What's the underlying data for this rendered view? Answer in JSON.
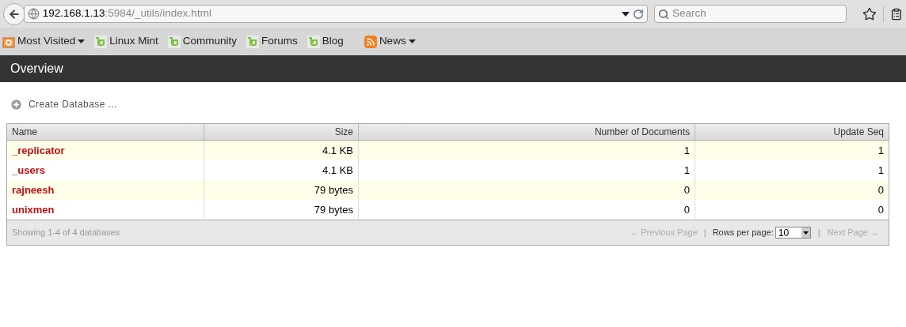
{
  "browser": {
    "url_host": "192.168.1.13",
    "url_rest": ":5984/_utils/index.html",
    "search": {
      "placeholder": "Search"
    }
  },
  "bookmarks": [
    {
      "kind": "folder",
      "label": "Most Visited",
      "menu": true
    },
    {
      "kind": "mint",
      "label": "Linux Mint",
      "menu": false
    },
    {
      "kind": "mint",
      "label": "Community",
      "menu": false
    },
    {
      "kind": "mint",
      "label": "Forums",
      "menu": false
    },
    {
      "kind": "mint",
      "label": "Blog",
      "menu": false
    },
    {
      "kind": "feed",
      "label": "News",
      "menu": true
    }
  ],
  "page": {
    "title": "Overview",
    "create_action": "Create Database ..."
  },
  "table": {
    "columns": [
      "Name",
      "Size",
      "Number of Documents",
      "Update Seq"
    ],
    "rows": [
      [
        "_replicator",
        "4.1 KB",
        "1",
        "1"
      ],
      [
        "_users",
        "4.1 KB",
        "1",
        "1"
      ],
      [
        "rajneesh",
        "79 bytes",
        "0",
        "0"
      ],
      [
        "unixmen",
        "79 bytes",
        "0",
        "0"
      ]
    ],
    "footer": {
      "summary": "Showing 1-4 of 4 databases",
      "previous": {
        "label": "← Previous Page",
        "disabled": true
      },
      "separator_1": "|",
      "rows_per_page_label": "Rows per page:",
      "rows_per_page": "10",
      "separator_2": "|",
      "next": {
        "label": "Next Page →",
        "disabled": true
      }
    }
  }
}
